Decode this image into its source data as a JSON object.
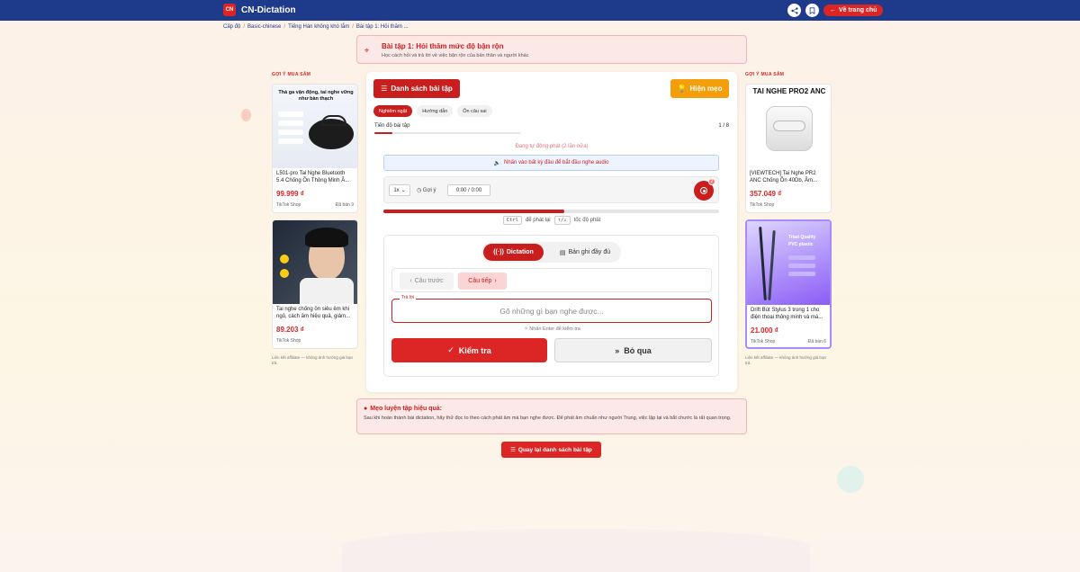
{
  "brand": {
    "name": "CN-Dictation",
    "logo_text": "CN"
  },
  "topbar": {
    "home_label": "Về trang chủ",
    "share_icon": "share-icon",
    "bookmark_icon": "bookmark-icon"
  },
  "breadcrumb": [
    "Cấp độ",
    "Basic-chinese",
    "Tiếng Hán không khó lắm",
    "Bài tập 1: Hỏi thăm ..."
  ],
  "lesson": {
    "title": "Bài tập 1: Hỏi thăm mức độ bận rộn",
    "subtitle": "Học cách hỏi và trả lời về việc bận rộn của bản thân và người khác"
  },
  "left_ads": {
    "title": "GỢI Ý MUA SẮM",
    "footer": "Liên kết affiliate — không ảnh hưởng giá bạn trả.",
    "items": [
      {
        "name": "L501-pro Tai Nghe Bluetooth 5.4 Chống Ồn Thông Minh Â...",
        "price": "99.999 ₫",
        "shop": "TikTok Shop",
        "sold": "Đã bán 9",
        "img_caption": "Thả ga vận động, tai nghe vững như bàn thạch"
      },
      {
        "name": "Tai nghe chống ồn siêu êm khi ngủ, cách âm hiệu quả, giảm...",
        "price": "89.203 ₫",
        "shop": "TikTok Shop",
        "sold": "",
        "img_caption": ""
      }
    ]
  },
  "right_ads": {
    "title": "GỢI Ý MUA SẮM",
    "footer": "Liên kết affiliate — không ảnh hưởng giá bạn trả.",
    "items": [
      {
        "name": "[VIEWTECH] Tai Nghe PR2 ANC Chống Ồn 40Db, Âm...",
        "price": "357.049 ₫",
        "shop": "TikTok Shop",
        "sold": "",
        "img_caption": "TAI NGHE PRO2 ANC"
      },
      {
        "name": "Drift Bút Stylus 3 trong 1 cho điện thoại thông minh và má...",
        "price": "21.000 ₫",
        "shop": "TikTok Shop",
        "sold": "Đã bán 6",
        "img_caption": "Triad  Quality PVC plastic"
      }
    ]
  },
  "toolbar": {
    "list_label": "Danh sách bài tập",
    "hint_label": "Hiện mẹo"
  },
  "tabs": [
    {
      "label": "Nghiêm ngặt",
      "active": true
    },
    {
      "label": "Hướng dẫn",
      "active": false
    },
    {
      "label": "Ôn câu sai",
      "active": false
    }
  ],
  "progress": {
    "label": "Tiến độ bài tập",
    "count": "1 / 8",
    "fraction": 0.125
  },
  "player": {
    "autoplay_text": "Đang tự động phát (2 lần nữa)",
    "notice": "Nhấn vào bất kỳ đâu để bắt đầu nghe audio",
    "speed": "1x",
    "hint": "Gợi ý",
    "time": "0:00 / 0:00",
    "badge": "2",
    "audio_fraction": 0.54
  },
  "shortcuts": {
    "key1": "Ctrl",
    "text1": "để phát lại",
    "key2": "↑/↓",
    "text2": "tốc độ phát"
  },
  "mode": {
    "active": "Dictation",
    "other": "Bản ghi đầy đủ"
  },
  "nav": {
    "prev": "Câu trước",
    "next": "Câu tiếp"
  },
  "answer": {
    "label": "Trả lời",
    "placeholder": "Gõ những gì bạn nghe được...",
    "enter_hint": "Nhấn Enter để kiểm tra"
  },
  "actions": {
    "check": "Kiểm tra",
    "skip": "Bỏ qua"
  },
  "tips": {
    "title": "Mẹo luyện tập hiệu quả:",
    "body": "Sau khi hoàn thành bài dictation, hãy thử đọc to theo cách phát âm mà bạn nghe được. Để phát âm chuẩn như người Trung, việc lặp lại và bắt chước là rất quan trọng."
  },
  "back_label": "Quay lại danh sách bài tập",
  "colors": {
    "primary": "#dc2626",
    "navy": "#1e3a8a",
    "amber": "#f59e0b"
  }
}
